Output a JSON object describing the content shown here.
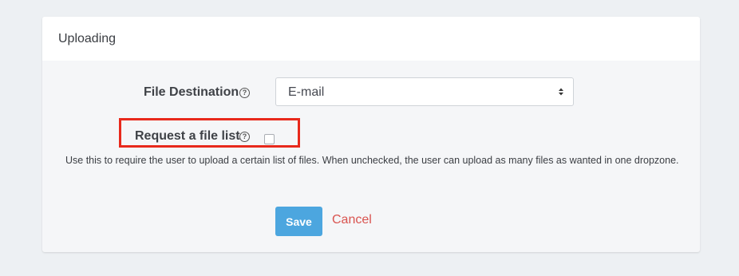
{
  "section": {
    "title": "Uploading"
  },
  "file_destination": {
    "label": "File Destination",
    "help_glyph": "?",
    "selected_value": "E-mail"
  },
  "request_file_list": {
    "label": "Request a file list",
    "help_glyph": "?",
    "checked": false,
    "help_text": "Use this to require the user to upload a certain list of files. When unchecked, the user can upload as many files as wanted in one dropzone."
  },
  "actions": {
    "save_label": "Save",
    "cancel_label": "Cancel"
  },
  "colors": {
    "save_button": "#4ca6df",
    "cancel_link": "#d9534f",
    "highlight_box": "#e8291c",
    "page_background": "#edf0f3"
  }
}
